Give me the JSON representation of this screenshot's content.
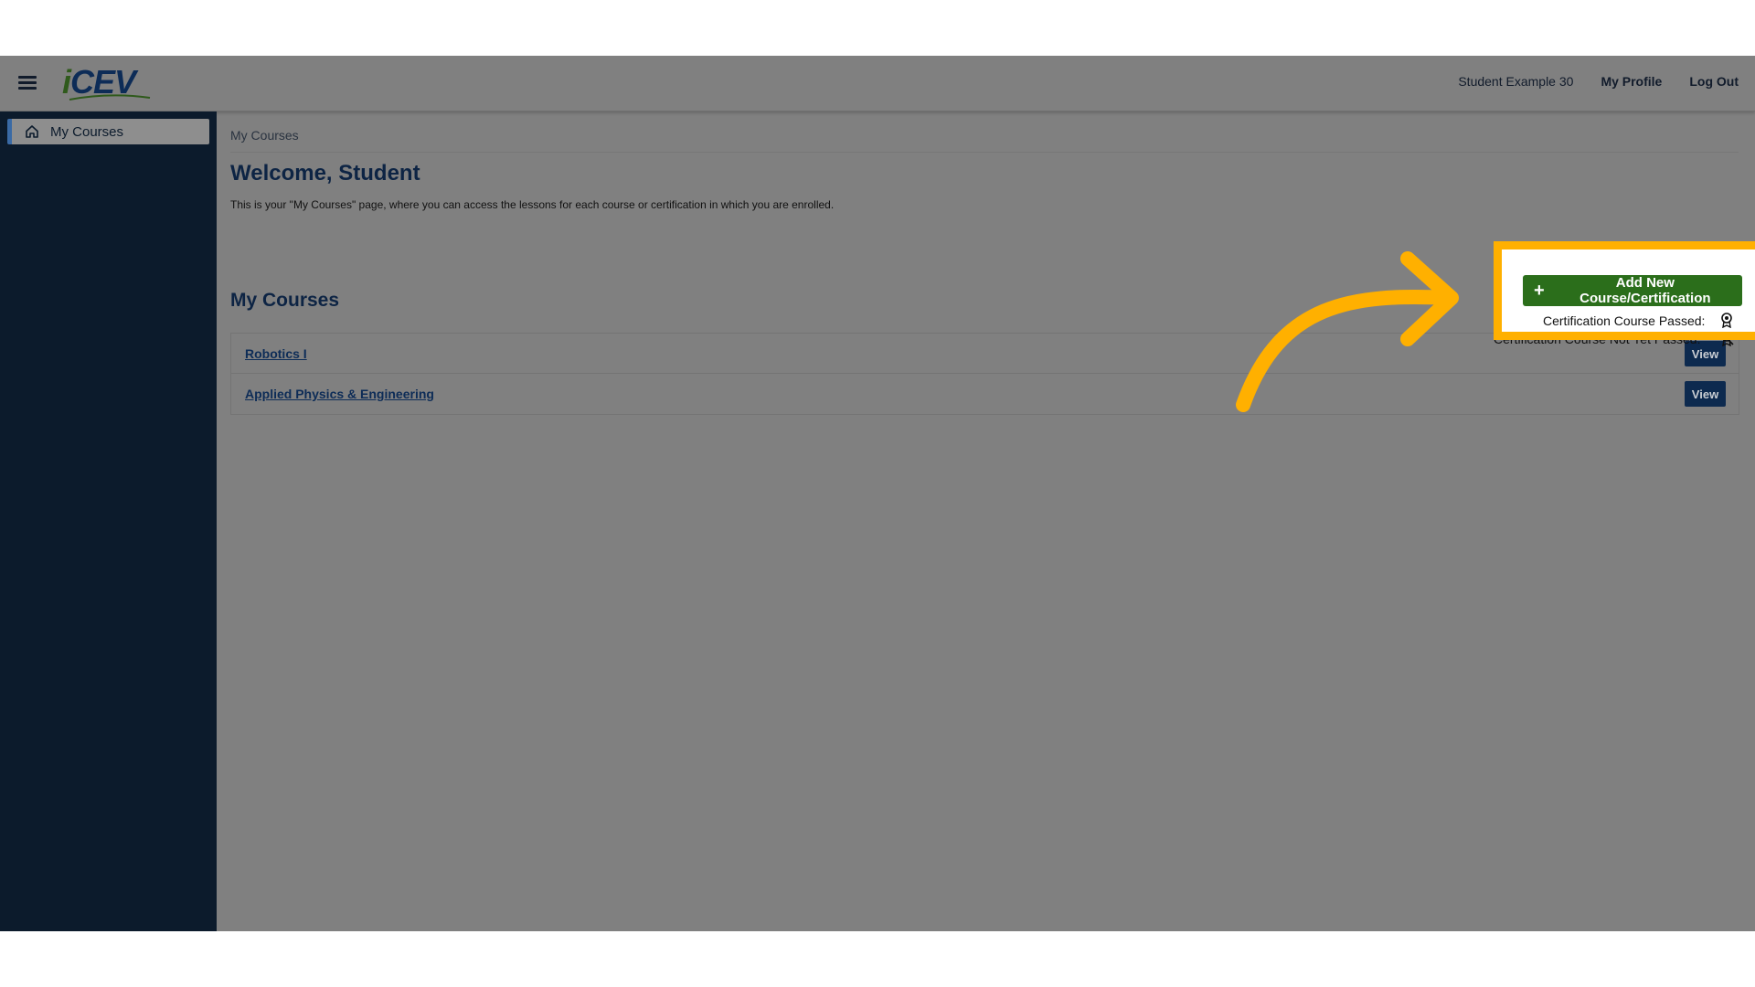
{
  "header": {
    "logo_text": "iCEV",
    "user_name": "Student Example 30",
    "my_profile": "My Profile",
    "log_out": "Log Out"
  },
  "sidebar": {
    "items": [
      {
        "label": "My Courses",
        "icon": "home-icon"
      }
    ]
  },
  "main": {
    "breadcrumb": "My Courses",
    "title": "Welcome, Student",
    "intro": "This is your \"My Courses\" page, where you can access the lessons for each course or certification in which you are enrolled.",
    "section_title": "My Courses",
    "courses": [
      {
        "name": "Robotics I",
        "action": "View"
      },
      {
        "name": "Applied Physics & Engineering",
        "action": "View"
      }
    ],
    "add_button": "Add New Course/Certification",
    "legend_passed": "Certification Course Passed:",
    "legend_not_passed": "Certification Course Not Yet Passed:"
  },
  "colors": {
    "sidebar_bg": "#0c1b2c",
    "overlay_gray": "#808080",
    "highlight": "#ffb000",
    "add_button": "#2b6e1b",
    "view_button": "#0d2a4f",
    "title": "#0d2444"
  }
}
